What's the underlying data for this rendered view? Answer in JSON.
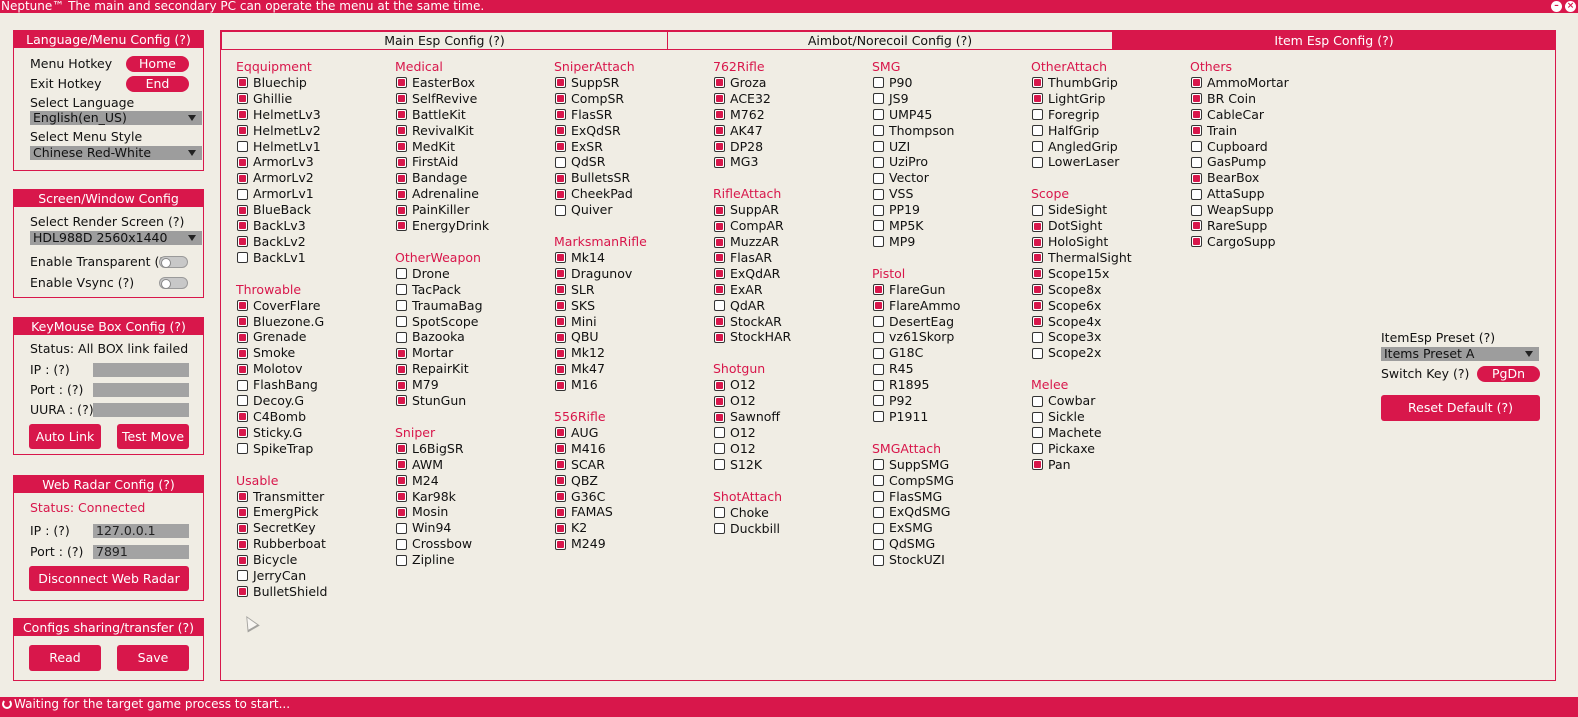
{
  "titlebar": {
    "title": "Neptune™  The main and secondary PC can operate the menu at the same time."
  },
  "statusbar": {
    "text": "Waiting for the target game process to start..."
  },
  "lang_panel": {
    "title": "Language/Menu Config (?)",
    "menu_hotkey_label": "Menu Hotkey",
    "menu_hotkey_value": "Home",
    "exit_hotkey_label": "Exit Hotkey",
    "exit_hotkey_value": "End",
    "select_language_label": "Select Language",
    "language_value": "English(en_US)",
    "select_style_label": "Select Menu Style",
    "style_value": "Chinese Red-White"
  },
  "screen_panel": {
    "title": "Screen/Window Config",
    "render_label": "Select Render Screen",
    "render_help": "(?)",
    "render_value": "HDL988D 2560x1440",
    "transparent_label": "Enable Transparent",
    "transparent_help": "(?)",
    "vsync_label": "Enable Vsync",
    "vsync_help": "(?)"
  },
  "keymouse_panel": {
    "title": "KeyMouse Box Config (?)",
    "status": "Status: All BOX link failed",
    "ip_label": "IP : (?)",
    "port_label": "Port : (?)",
    "uura_label": "UURA : (?)",
    "auto_link": "Auto Link",
    "test_move": "Test Move"
  },
  "radar_panel": {
    "title": "Web Radar Config (?)",
    "status": "Status: Connected",
    "ip_label": "IP : (?)",
    "ip_value": "127.0.0.1",
    "port_label": "Port : (?)",
    "port_value": "7891",
    "disconnect": "Disconnect Web Radar"
  },
  "share_panel": {
    "title": "Configs sharing/transfer (?)",
    "read": "Read",
    "save": "Save"
  },
  "tabs": [
    {
      "label": "Main Esp Config (?)"
    },
    {
      "label": "Aimbot/Norecoil Config (?)"
    },
    {
      "label": "Item Esp Config (?)"
    }
  ],
  "preset": {
    "label": "ItemEsp Preset",
    "help": "(?)",
    "value": "Items Preset A",
    "switch_label": "Switch Key",
    "switch_help": "(?)",
    "switch_value": "PgDn",
    "reset": "Reset Default (?)"
  },
  "columns": [
    [
      {
        "name": "Eqquipment",
        "items": [
          [
            "Bluechip",
            1
          ],
          [
            "Ghillie",
            1
          ],
          [
            "HelmetLv3",
            1
          ],
          [
            "HelmetLv2",
            1
          ],
          [
            "HelmetLv1",
            0
          ],
          [
            "ArmorLv3",
            1
          ],
          [
            "ArmorLv2",
            1
          ],
          [
            "ArmorLv1",
            0
          ],
          [
            "BlueBack",
            1
          ],
          [
            "BackLv3",
            1
          ],
          [
            "BackLv2",
            1
          ],
          [
            "BackLv1",
            0
          ]
        ]
      },
      {
        "name": "Throwable",
        "items": [
          [
            "CoverFlare",
            1
          ],
          [
            "Bluezone.G",
            1
          ],
          [
            "Grenade",
            1
          ],
          [
            "Smoke",
            1
          ],
          [
            "Molotov",
            1
          ],
          [
            "FlashBang",
            0
          ],
          [
            "Decoy.G",
            0
          ],
          [
            "C4Bomb",
            1
          ],
          [
            "Sticky.G",
            1
          ],
          [
            "SpikeTrap",
            0
          ]
        ]
      },
      {
        "name": "Usable",
        "items": [
          [
            "Transmitter",
            1
          ],
          [
            "EmergPick",
            1
          ],
          [
            "SecretKey",
            1
          ],
          [
            "Rubberboat",
            1
          ],
          [
            "Bicycle",
            1
          ],
          [
            "JerryCan",
            0
          ],
          [
            "BulletShield",
            1
          ]
        ]
      }
    ],
    [
      {
        "name": "Medical",
        "items": [
          [
            "EasterBox",
            1
          ],
          [
            "SelfRevive",
            1
          ],
          [
            "BattleKit",
            1
          ],
          [
            "RevivalKit",
            1
          ],
          [
            "MedKit",
            1
          ],
          [
            "FirstAid",
            1
          ],
          [
            "Bandage",
            1
          ],
          [
            "Adrenaline",
            1
          ],
          [
            "PainKiller",
            1
          ],
          [
            "EnergyDrink",
            1
          ]
        ]
      },
      {
        "name": "OtherWeapon",
        "items": [
          [
            "Drone",
            0
          ],
          [
            "TacPack",
            0
          ],
          [
            "TraumaBag",
            0
          ],
          [
            "SpotScope",
            0
          ],
          [
            "Bazooka",
            0
          ],
          [
            "Mortar",
            1
          ],
          [
            "RepairKit",
            1
          ],
          [
            "M79",
            1
          ],
          [
            "StunGun",
            1
          ]
        ]
      },
      {
        "name": "Sniper",
        "items": [
          [
            "L6BigSR",
            1
          ],
          [
            "AWM",
            1
          ],
          [
            "M24",
            1
          ],
          [
            "Kar98k",
            1
          ],
          [
            "Mosin",
            1
          ],
          [
            "Win94",
            0
          ],
          [
            "Crossbow",
            0
          ],
          [
            "Zipline",
            0
          ]
        ]
      }
    ],
    [
      {
        "name": "SniperAttach",
        "items": [
          [
            "SuppSR",
            1
          ],
          [
            "CompSR",
            1
          ],
          [
            "FlasSR",
            1
          ],
          [
            "ExQdSR",
            1
          ],
          [
            "ExSR",
            1
          ],
          [
            "QdSR",
            0
          ],
          [
            "BulletsSR",
            1
          ],
          [
            "CheekPad",
            1
          ],
          [
            "Quiver",
            0
          ]
        ]
      },
      {
        "name": "MarksmanRifle",
        "items": [
          [
            "Mk14",
            1
          ],
          [
            "Dragunov",
            1
          ],
          [
            "SLR",
            1
          ],
          [
            "SKS",
            1
          ],
          [
            "Mini",
            1
          ],
          [
            "QBU",
            1
          ],
          [
            "Mk12",
            1
          ],
          [
            "Mk47",
            1
          ],
          [
            "M16",
            1
          ]
        ]
      },
      {
        "name": "556Rifle",
        "items": [
          [
            "AUG",
            1
          ],
          [
            "M416",
            1
          ],
          [
            "SCAR",
            1
          ],
          [
            "QBZ",
            1
          ],
          [
            "G36C",
            1
          ],
          [
            "FAMAS",
            1
          ],
          [
            "K2",
            1
          ],
          [
            "M249",
            1
          ]
        ]
      }
    ],
    [
      {
        "name": "762Rifle",
        "items": [
          [
            "Groza",
            1
          ],
          [
            "ACE32",
            1
          ],
          [
            "M762",
            1
          ],
          [
            "AK47",
            1
          ],
          [
            "DP28",
            1
          ],
          [
            "MG3",
            1
          ]
        ]
      },
      {
        "name": "RifleAttach",
        "items": [
          [
            "SuppAR",
            1
          ],
          [
            "CompAR",
            1
          ],
          [
            "MuzzAR",
            1
          ],
          [
            "FlasAR",
            1
          ],
          [
            "ExQdAR",
            1
          ],
          [
            "ExAR",
            1
          ],
          [
            "QdAR",
            0
          ],
          [
            "StockAR",
            1
          ],
          [
            "StockHAR",
            1
          ]
        ]
      },
      {
        "name": "Shotgun",
        "items": [
          [
            "O12",
            1
          ],
          [
            "O12",
            1
          ],
          [
            "Sawnoff",
            1
          ],
          [
            "O12",
            0
          ],
          [
            "O12",
            0
          ],
          [
            "S12K",
            0
          ]
        ]
      },
      {
        "name": "ShotAttach",
        "items": [
          [
            "Choke",
            0
          ],
          [
            "Duckbill",
            0
          ]
        ]
      }
    ],
    [
      {
        "name": "SMG",
        "items": [
          [
            "P90",
            0
          ],
          [
            "JS9",
            0
          ],
          [
            "UMP45",
            0
          ],
          [
            "Thompson",
            0
          ],
          [
            "UZI",
            0
          ],
          [
            "UziPro",
            0
          ],
          [
            "Vector",
            0
          ],
          [
            "VSS",
            0
          ],
          [
            "PP19",
            0
          ],
          [
            "MP5K",
            0
          ],
          [
            "MP9",
            0
          ]
        ]
      },
      {
        "name": "Pistol",
        "items": [
          [
            "FlareGun",
            1
          ],
          [
            "FlareAmmo",
            1
          ],
          [
            "DesertEag",
            0
          ],
          [
            "vz61Skorp",
            0
          ],
          [
            "G18C",
            0
          ],
          [
            "R45",
            0
          ],
          [
            "R1895",
            0
          ],
          [
            "P92",
            0
          ],
          [
            "P1911",
            0
          ]
        ]
      },
      {
        "name": "SMGAttach",
        "items": [
          [
            "SuppSMG",
            0
          ],
          [
            "CompSMG",
            0
          ],
          [
            "FlasSMG",
            0
          ],
          [
            "ExQdSMG",
            0
          ],
          [
            "ExSMG",
            0
          ],
          [
            "QdSMG",
            0
          ],
          [
            "StockUZI",
            0
          ]
        ]
      }
    ],
    [
      {
        "name": "OtherAttach",
        "items": [
          [
            "ThumbGrip",
            1
          ],
          [
            "LightGrip",
            1
          ],
          [
            "Foregrip",
            0
          ],
          [
            "HalfGrip",
            0
          ],
          [
            "AngledGrip",
            0
          ],
          [
            "LowerLaser",
            0
          ]
        ]
      },
      {
        "name": "Scope",
        "items": [
          [
            "SideSight",
            0
          ],
          [
            "DotSight",
            1
          ],
          [
            "HoloSight",
            1
          ],
          [
            "ThermalSight",
            1
          ],
          [
            "Scope15x",
            1
          ],
          [
            "Scope8x",
            1
          ],
          [
            "Scope6x",
            1
          ],
          [
            "Scope4x",
            1
          ],
          [
            "Scope3x",
            0
          ],
          [
            "Scope2x",
            0
          ]
        ]
      },
      {
        "name": "Melee",
        "items": [
          [
            "Cowbar",
            0
          ],
          [
            "Sickle",
            0
          ],
          [
            "Machete",
            0
          ],
          [
            "Pickaxe",
            0
          ],
          [
            "Pan",
            1
          ]
        ]
      }
    ],
    [
      {
        "name": "Others",
        "items": [
          [
            "AmmoMortar",
            1
          ],
          [
            "BR Coin",
            1
          ],
          [
            "CableCar",
            1
          ],
          [
            "Train",
            1
          ],
          [
            "Cupboard",
            0
          ],
          [
            "GasPump",
            0
          ],
          [
            "BearBox",
            1
          ],
          [
            "AttaSupp",
            0
          ],
          [
            "WeapSupp",
            0
          ],
          [
            "RareSupp",
            1
          ],
          [
            "CargoSupp",
            1
          ]
        ]
      }
    ]
  ]
}
